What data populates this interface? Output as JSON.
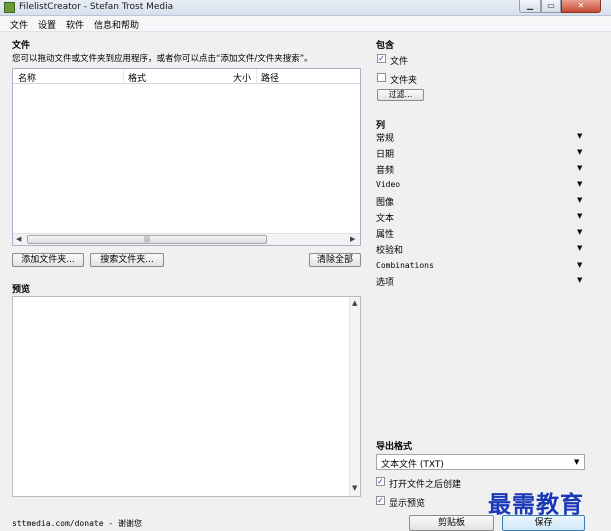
{
  "window": {
    "title": "FilelistCreator - Stefan Trost Media",
    "controls": {
      "minimize": "▁",
      "maximize": "▭",
      "close": "✕"
    }
  },
  "menu": [
    "文件",
    "设置",
    "软件",
    "信息和帮助"
  ],
  "files": {
    "heading": "文件",
    "hint": "您可以拖动文件或文件夹到应用程序，或者你可以点击“添加文件/文件夹搜索”。",
    "columns": [
      "名称",
      "格式",
      "大小",
      "路径"
    ],
    "scroll_grip": "|||",
    "add_folder_button": "添加文件夹...",
    "search_folder_button": "搜索文件夹...",
    "clear_all_button": "清除全部"
  },
  "preview": {
    "heading": "预览"
  },
  "include": {
    "heading": "包含",
    "files_label": "文件",
    "files_checked": true,
    "folders_label": "文件夹",
    "folders_checked": false,
    "filter_button": "过滤..."
  },
  "columns_panel": {
    "heading": "列",
    "items": [
      "常规",
      "日期",
      "音频",
      "Video",
      "图像",
      "文本",
      "属性",
      "校验和",
      "Combinations",
      "选项"
    ]
  },
  "export": {
    "heading": "导出格式",
    "format_value": "文本文件 (TXT)",
    "open_after_label": "打开文件之后创建",
    "open_after_checked": true,
    "show_preview_label": "显示预览",
    "show_preview_checked": true,
    "clipboard_button": "剪贴板",
    "save_button": "保存"
  },
  "status": {
    "text": "sttmedia.com/donate - 谢谢您"
  },
  "watermark": {
    "text": "最需教育"
  },
  "colors": {
    "accent": "#1a38b8",
    "close": "#c74b32"
  }
}
